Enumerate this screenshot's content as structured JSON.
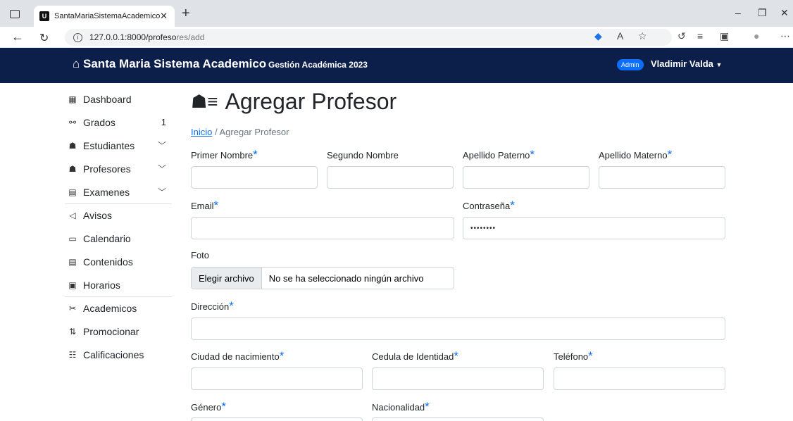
{
  "browser": {
    "tab_title": "SantaMariaSistemaAcademico",
    "tab_favicon": "U",
    "url_host": "127.0.0.1:8000/profeso",
    "url_path": "res/add"
  },
  "navbar": {
    "brand": "Santa Maria Sistema Academico",
    "subtitle": "Gestión Académica 2023",
    "role_badge": "Admin",
    "user_name": "Vladimir Valda"
  },
  "sidebar": {
    "items": [
      {
        "label": "Dashboard",
        "icon": "grid-icon"
      },
      {
        "label": "Grados",
        "icon": "hierarchy-icon",
        "count": "1"
      },
      {
        "label": "Estudiantes",
        "icon": "users-list-icon"
      },
      {
        "label": "Profesores",
        "icon": "users-list-icon"
      },
      {
        "label": "Examenes",
        "icon": "document-icon"
      },
      {
        "label": "Avisos",
        "icon": "megaphone-icon"
      },
      {
        "label": "Calendario",
        "icon": "calendar-icon"
      },
      {
        "label": "Contenidos",
        "icon": "file-text-icon"
      },
      {
        "label": "Horarios",
        "icon": "schedule-icon"
      },
      {
        "label": "Academicos",
        "icon": "tools-icon"
      },
      {
        "label": "Promocionar",
        "icon": "sort-icon"
      },
      {
        "label": "Calificaciones",
        "icon": "grades-icon"
      }
    ]
  },
  "page": {
    "title": "Agregar Profesor",
    "breadcrumb_home": "Inicio",
    "breadcrumb_current": "Agregar Profesor"
  },
  "form": {
    "required_mark": "*",
    "primer_nombre": "Primer Nombre",
    "segundo_nombre": "Segundo Nombre",
    "apellido_paterno": "Apellido Paterno",
    "apellido_materno": "Apellido Materno",
    "email": "Email",
    "contrasena": "Contraseña",
    "contrasena_value": "••••••••",
    "foto": "Foto",
    "file_button": "Elegir archivo",
    "file_status": "No se ha seleccionado ningún archivo",
    "direccion": "Dirección",
    "ciudad": "Ciudad de nacimiento",
    "cedula": "Cedula de Identidad",
    "telefono": "Teléfono",
    "genero": "Género",
    "nacionalidad": "Nacionalidad"
  }
}
